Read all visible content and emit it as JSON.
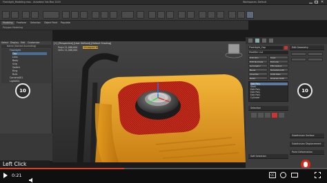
{
  "titlebar": {
    "title": "Flashlight_Modeling.max - Autodesk 3ds Max 2019",
    "workspace": "Workspaces: Default"
  },
  "menu": [
    "File",
    "Edit",
    "Tools",
    "Group",
    "Views",
    "Create",
    "Modifiers",
    "Animation",
    "Graph Editors",
    "Rendering",
    "Civil View",
    "Customize",
    "Scripting",
    "Interactive",
    "Content",
    "Arnold",
    "Help"
  ],
  "ribbon": {
    "tabs": [
      "Modeling",
      "Freeform",
      "Selection",
      "Object Paint",
      "Populate"
    ],
    "subtitle": "Polygon Modeling"
  },
  "scene_explorer": {
    "tabs": [
      "Select",
      "Display",
      "Edit",
      "Customize"
    ],
    "header": "Name (Sorted Ascending)",
    "items": [
      "Flashlight",
      "Cap",
      "Lens",
      "Body",
      "Grip",
      "Switch",
      "Ring",
      "Bulb",
      "Camera001",
      "Light001"
    ]
  },
  "viewport": {
    "label": "[+] [Perspective] [User Defined] [Default Shading]",
    "stats": [
      "Polys  21,088,000",
      "Verts  21,088,000"
    ],
    "bubble": "Uncapped 60"
  },
  "right_panel": {
    "object_name": "Flashlight_Cap",
    "modifier_list": "Modifier List",
    "buttons": [
      "Edit Poly",
      "Shell",
      "Edit Normals",
      "Extrude",
      "Symmetry",
      "FFD 4x4x4",
      "Bevel",
      "TurboSmooth",
      "Chamfer",
      "UVW Map",
      "Relax",
      "Unwrap UVW"
    ],
    "stack": [
      "Edit Poly",
      "Shell",
      "Edit Poly",
      "Edit Poly",
      "Edit Poly",
      "Cylinder"
    ],
    "sections": [
      "Selection",
      "Soft Selection",
      "Edit Geometry",
      "Subdivision Surface",
      "Subdivision Displacement",
      "Paint Deformation"
    ],
    "side_label": "Edit Geometry"
  },
  "overlay": {
    "label": "Left Click"
  },
  "player": {
    "time": "0:21",
    "skip_back": "10",
    "skip_forward": "10"
  }
}
